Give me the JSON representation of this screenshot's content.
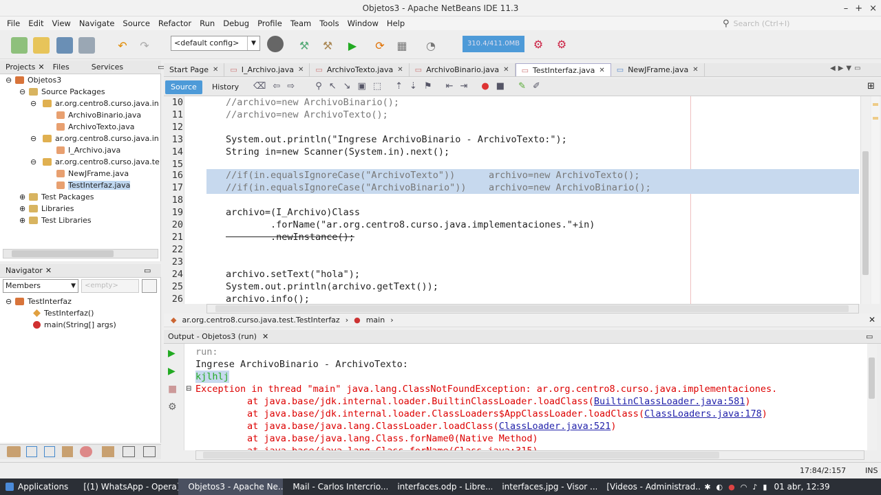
{
  "window": {
    "title": "Objetos3 - Apache NetBeans IDE 11.3"
  },
  "menu": [
    "File",
    "Edit",
    "View",
    "Navigate",
    "Source",
    "Refactor",
    "Run",
    "Debug",
    "Profile",
    "Team",
    "Tools",
    "Window",
    "Help"
  ],
  "search": {
    "placeholder": "Search (Ctrl+I)"
  },
  "toolbar": {
    "config": "<default config>",
    "memory": "310.4/411.0MB"
  },
  "projects_panel": {
    "tabs": [
      "Projects",
      "Files",
      "Services"
    ],
    "tree": [
      {
        "label": "Objetos3"
      },
      {
        "label": "Source Packages"
      },
      {
        "label": "ar.org.centro8.curso.java.in"
      },
      {
        "label": "ArchivoBinario.java"
      },
      {
        "label": "ArchivoTexto.java"
      },
      {
        "label": "ar.org.centro8.curso.java.in"
      },
      {
        "label": "I_Archivo.java"
      },
      {
        "label": "ar.org.centro8.curso.java.te"
      },
      {
        "label": "NewJFrame.java"
      },
      {
        "label": "TestInterfaz.java"
      },
      {
        "label": "Test Packages"
      },
      {
        "label": "Libraries"
      },
      {
        "label": "Test Libraries"
      }
    ]
  },
  "navigator": {
    "title": "Navigator",
    "filter": "Members",
    "empty": "<empty>",
    "tree": [
      "TestInterfaz",
      "TestInterfaz()",
      "main(String[] args)"
    ]
  },
  "editor": {
    "tabs": [
      "Start Page",
      "I_Archivo.java",
      "ArchivoTexto.java",
      "ArchivoBinario.java",
      "TestInterfaz.java",
      "NewJFrame.java"
    ],
    "source_label": "Source",
    "history_label": "History",
    "lines": [
      {
        "n": "10",
        "t": "//archivo=new ArchivoBinario();"
      },
      {
        "n": "11",
        "t": "//archivo=new ArchivoTexto();"
      },
      {
        "n": "12",
        "t": ""
      },
      {
        "n": "13",
        "t": "System.out.println(\"Ingrese ArchivoBinario - ArchivoTexto:\");"
      },
      {
        "n": "14",
        "t": "String in=new Scanner(System.in).next();"
      },
      {
        "n": "15",
        "t": ""
      },
      {
        "n": "16",
        "t": "//if(in.equalsIgnoreCase(\"ArchivoTexto\"))      archivo=new ArchivoTexto();"
      },
      {
        "n": "17",
        "t": "//if(in.equalsIgnoreCase(\"ArchivoBinario\"))    archivo=new ArchivoBinario();"
      },
      {
        "n": "18",
        "t": ""
      },
      {
        "n": "19",
        "t": "archivo=(I_Archivo)Class"
      },
      {
        "n": "20",
        "t": "        .forName(\"ar.org.centro8.curso.java.implementaciones.\"+in)"
      },
      {
        "n": "21",
        "t": "        .newInstance();"
      },
      {
        "n": "22",
        "t": ""
      },
      {
        "n": "23",
        "t": ""
      },
      {
        "n": "24",
        "t": "archivo.setText(\"hola\");"
      },
      {
        "n": "25",
        "t": "System.out.println(archivo.getText());"
      },
      {
        "n": "26",
        "t": "archivo.info();"
      }
    ],
    "breadcrumb": [
      "ar.org.centro8.curso.java.test.TestInterfaz",
      "main"
    ]
  },
  "output": {
    "tab": "Output - Objetos3 (run)",
    "lines": [
      "run:",
      "Ingrese ArchivoBinario - ArchivoTexto:",
      "kjlhlj",
      "Exception in thread \"main\" java.lang.ClassNotFoundException: ar.org.centro8.curso.java.implementaciones.",
      "at java.base/jdk.internal.loader.BuiltinClassLoader.loadClass(",
      "BuiltinClassLoader.java:581",
      "at java.base/jdk.internal.loader.ClassLoaders$AppClassLoader.loadClass(",
      "ClassLoaders.java:178",
      "at java.base/java.lang.ClassLoader.loadClass(",
      "ClassLoader.java:521",
      "at java.base/java.lang.Class.forName0(Native Method)",
      "at java.base/java.lang.Class.forName(Class.java:315)"
    ]
  },
  "status": {
    "position": "17:84/2:157",
    "mode": "INS"
  },
  "taskbar": {
    "items": [
      "Applications",
      "[(1) WhatsApp - Opera]",
      "Objetos3 - Apache Ne...",
      "Mail - Carlos Intercrio...",
      "interfaces.odp - Libre...",
      "interfaces.jpg - Visor ...",
      "[Videos - Administrad..."
    ],
    "clock": "01 abr, 12:39"
  }
}
